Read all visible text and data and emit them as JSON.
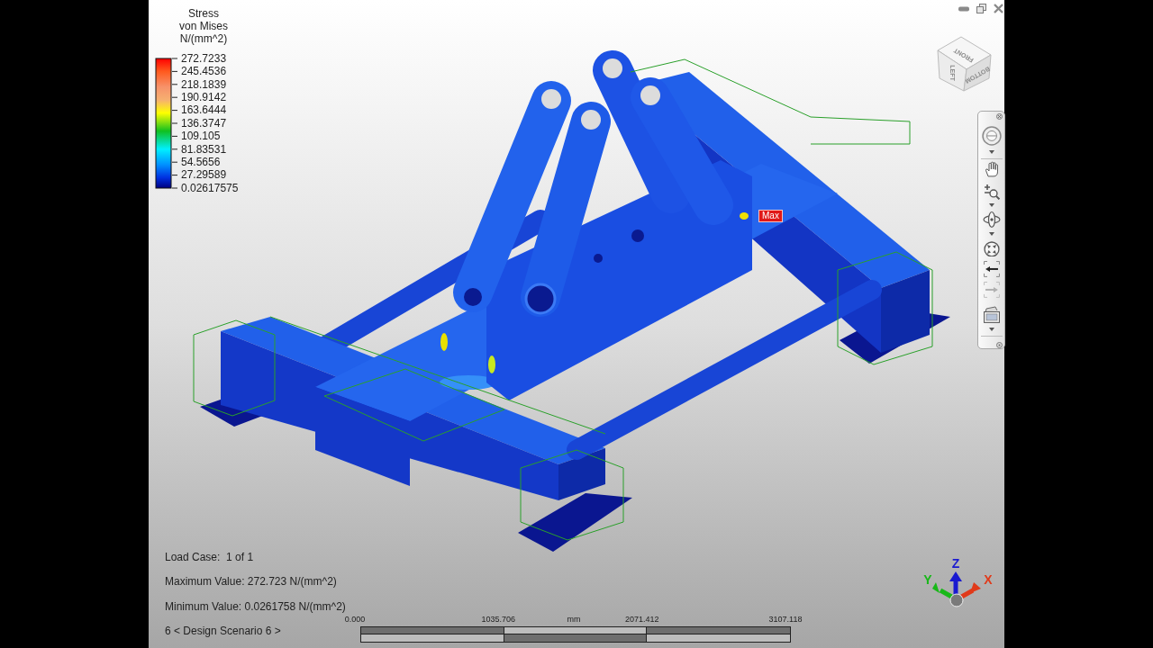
{
  "legend": {
    "title": [
      "Stress",
      "von Mises",
      "N/(mm^2)"
    ],
    "values": [
      "272.7233",
      "245.4536",
      "218.1839",
      "190.9142",
      "163.6444",
      "136.3747",
      "109.105",
      "81.83531",
      "54.5656",
      "27.29589",
      "0.02617575"
    ]
  },
  "view_cube": {
    "faces": [
      "FRONT",
      "LEFT",
      "BOTTOM"
    ]
  },
  "navigation_bar": {
    "history": [
      {
        "disabled": false
      },
      {
        "disabled": true
      }
    ]
  },
  "model": {
    "max_label": "Max"
  },
  "status_lines": [
    "Load Case:  1 of 1",
    "Maximum Value: 272.723 N/(mm^2)",
    "Minimum Value: 0.0261758 N/(mm^2)",
    "6 < Design Scenario 6 >"
  ],
  "scale_bar": {
    "ticks": [
      "0.000",
      "1035.706",
      "2071.412",
      "3107.118"
    ],
    "unit": "mm"
  },
  "axis_triad": [
    {
      "label": "Z",
      "color": "#1a1ad0"
    },
    {
      "label": "Y",
      "color": "#18b818"
    },
    {
      "label": "X",
      "color": "#e03a1a"
    }
  ]
}
